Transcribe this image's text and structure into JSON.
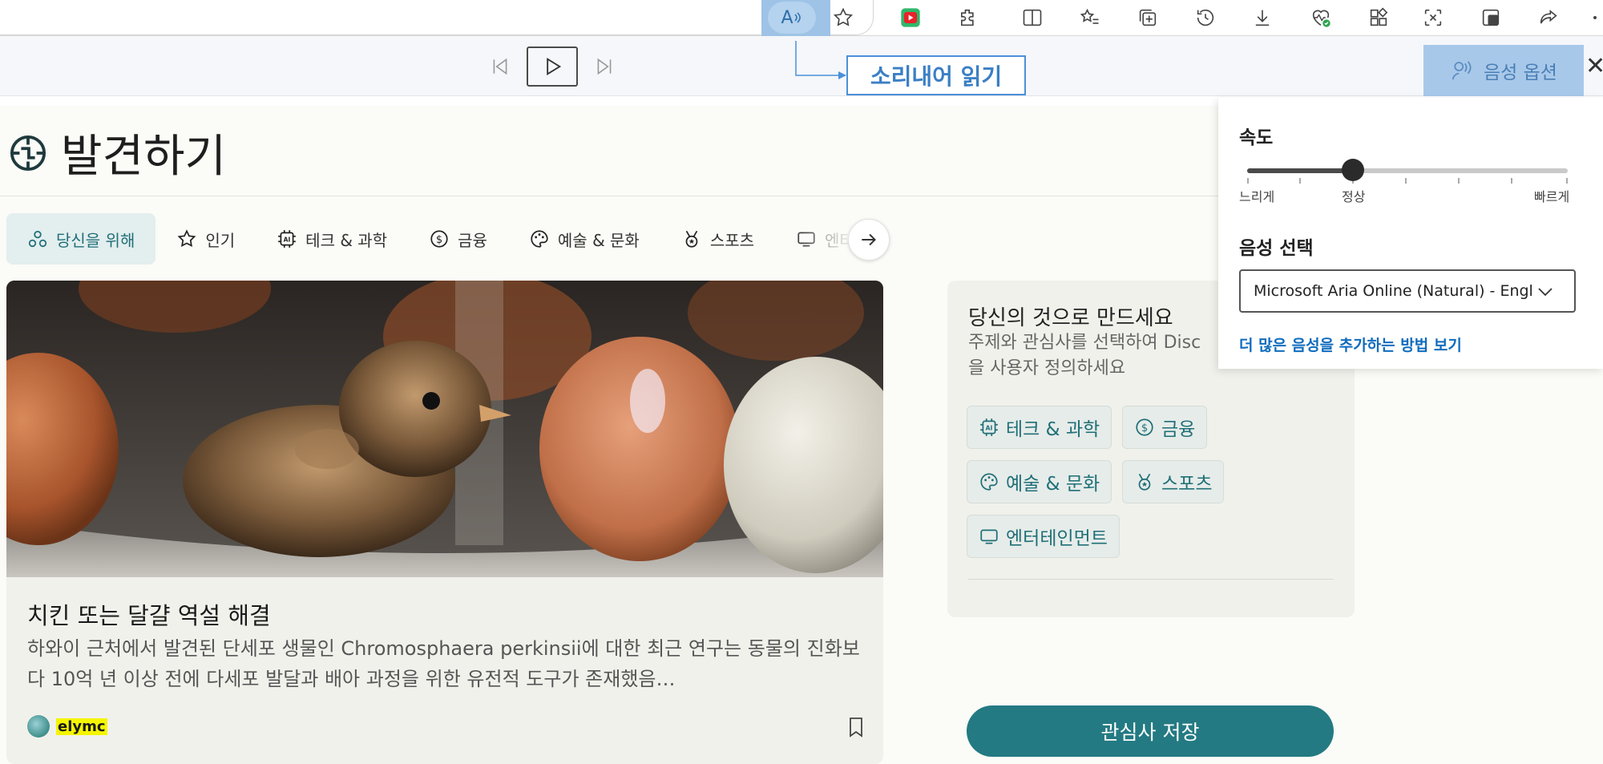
{
  "toolbar": {
    "read_aloud_glyph": "A",
    "icons": [
      "read-aloud-icon",
      "favorite-star-icon",
      "youtube-extension-icon",
      "extensions-icon",
      "split-screen-icon",
      "favorites-icon",
      "collections-icon",
      "history-icon",
      "downloads-icon",
      "browser-essentials-icon",
      "apps-icon",
      "screenshot-icon",
      "workspaces-icon",
      "share-icon",
      "more-icon"
    ]
  },
  "readbar": {
    "callout": "소리내어 읽기",
    "voice_options_label": "음성 옵션"
  },
  "page": {
    "title": "발견하기",
    "categories": [
      {
        "label": "당신을 위해",
        "icon": "for-you-icon"
      },
      {
        "label": "인기",
        "icon": "star-icon"
      },
      {
        "label": "테크 & 과학",
        "icon": "ai-chip-icon"
      },
      {
        "label": "금융",
        "icon": "dollar-icon"
      },
      {
        "label": "예술 & 문화",
        "icon": "palette-icon"
      },
      {
        "label": "스포츠",
        "icon": "medal-icon"
      },
      {
        "label": "엔터",
        "icon": "tv-icon"
      }
    ]
  },
  "article": {
    "title": "치킨 또는 달걀 역설 해결",
    "description": "하와이 근처에서 발견된 단세포 생물인 Chromosphaera perkinsii에 대한 최근 연구는 동물의 진화보다 10억 년 이상 전에 다세포 발달과 배아 과정을 위한 유전적 도구가 존재했음…",
    "author": "elymc"
  },
  "personalize": {
    "title": "당신의 것으로 만드세요",
    "description_line1": "주제와 관심사를 선택하여 Disc",
    "description_line2": "을 사용자 정의하세요",
    "chips": [
      "테크 & 과학",
      "금융",
      "예술 & 문화",
      "스포츠",
      "엔터테인먼트"
    ],
    "save_label": "관심사 저장"
  },
  "voice_popup": {
    "speed_label": "속도",
    "slow_label": "느리게",
    "normal_label": "정상",
    "fast_label": "빠르게",
    "speed_value_fraction": 0.33,
    "voice_label": "음성 선택",
    "selected_voice": "Microsoft Aria Online (Natural) - Engl",
    "link": "더 많은 음성을 추가하는 방법 보기"
  }
}
